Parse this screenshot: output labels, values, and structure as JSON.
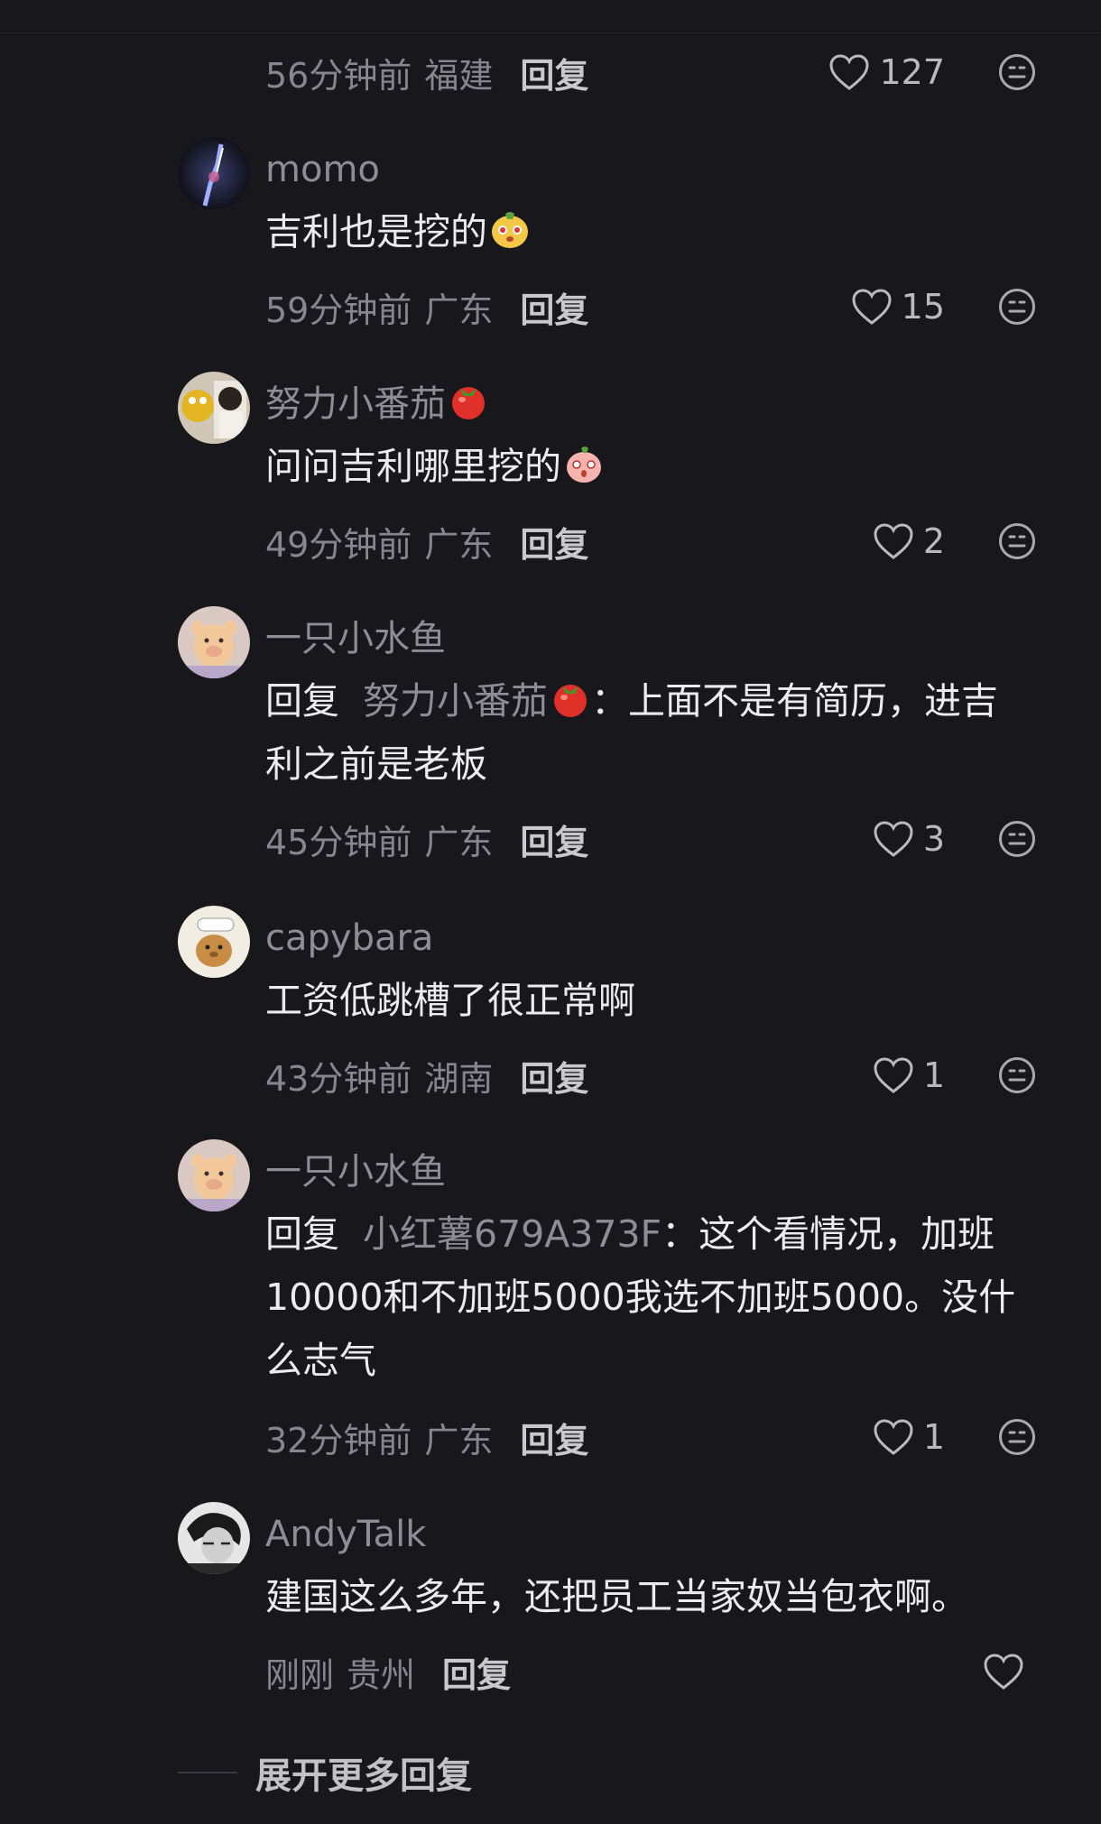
{
  "first": {
    "time": "56分钟前",
    "location": "福建",
    "reply": "回复",
    "likes": "127"
  },
  "comments": [
    {
      "name": "momo",
      "text": "吉利也是挖的",
      "time": "59分钟前",
      "location": "广东",
      "reply": "回复",
      "likes": "15"
    },
    {
      "name": "努力小番茄",
      "text": "问问吉利哪里挖的",
      "time": "49分钟前",
      "location": "广东",
      "reply": "回复",
      "likes": "2"
    },
    {
      "name": "一只小水鱼",
      "reply_word": "回复",
      "mention": "努力小番茄",
      "text": "：上面不是有简历，进吉利之前是老板",
      "time": "45分钟前",
      "location": "广东",
      "reply": "回复",
      "likes": "3"
    },
    {
      "name": "capybara",
      "text": "工资低跳槽了很正常啊",
      "time": "43分钟前",
      "location": "湖南",
      "reply": "回复",
      "likes": "1"
    },
    {
      "name": "一只小水鱼",
      "reply_word": "回复",
      "mention": "小红薯679A373F",
      "text": "：这个看情况，加班10000和不加班5000我选不加班5000。没什么志气",
      "time": "32分钟前",
      "location": "广东",
      "reply": "回复",
      "likes": "1"
    },
    {
      "name": "AndyTalk",
      "text": "建国这么多年，还把员工当家奴当包衣啊。",
      "time": "刚刚",
      "location": "贵州",
      "reply": "回复",
      "likes": ""
    }
  ],
  "expand_label": "展开更多回复",
  "colors": {
    "background": "#17171c",
    "muted": "#8d8d93",
    "text": "#ececef"
  }
}
